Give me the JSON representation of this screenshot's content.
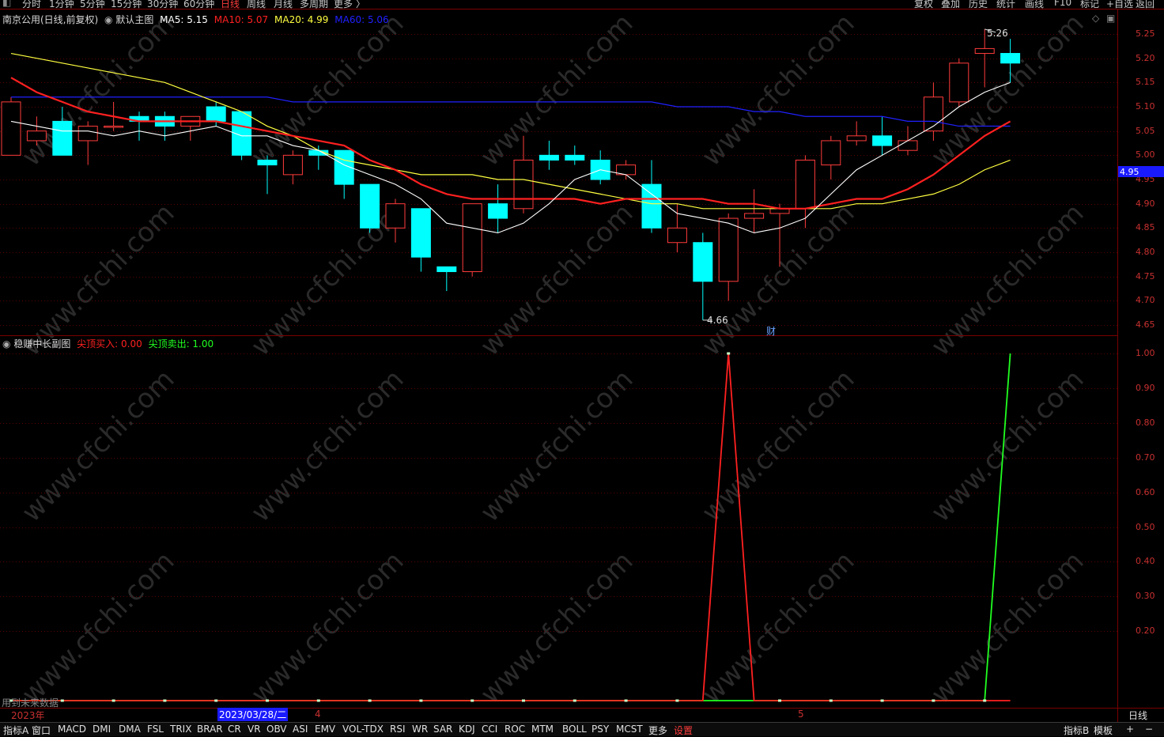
{
  "toolbar": {
    "tabs": [
      "分时",
      "1分钟",
      "5分钟",
      "15分钟",
      "30分钟",
      "60分钟",
      "日线",
      "周线",
      "月线",
      "多周期",
      "更多 〉"
    ],
    "active_tab": "日线",
    "right_tools": [
      "复权",
      "叠加",
      "历史",
      "统计",
      "画线",
      "F10",
      "标记",
      "+自选",
      "返回"
    ]
  },
  "main_chart": {
    "legend": {
      "title": "南京公用(日线,前复权)",
      "template": "默认主图",
      "ma5": "MA5: 5.15",
      "ma10": "MA10: 5.07",
      "ma20": "MA20: 4.99",
      "ma60": "MA60: 5.06"
    },
    "price_ticks": [
      "5.25",
      "5.20",
      "5.15",
      "5.10",
      "5.05",
      "5.00",
      "4.95",
      "4.90",
      "4.85",
      "4.80",
      "4.75",
      "4.70",
      "4.65"
    ],
    "current_price": "4.95",
    "high_label": "5.26",
    "low_label": "4.66",
    "finance_marker": "财",
    "colors": {
      "up": "#ff3b3b",
      "down": "#00ffff",
      "ma5": "#ffffff",
      "ma10": "#ff2020",
      "ma20": "#ffff40",
      "ma60": "#2020ff"
    }
  },
  "sub_chart": {
    "legend": {
      "title": "稳赚中长副图",
      "buy": "尖顶买入: 0.00",
      "sell": "尖顶卖出: 1.00"
    },
    "ticks": [
      "1.00",
      "0.90",
      "0.80",
      "0.70",
      "0.60",
      "0.50",
      "0.40",
      "0.30",
      "0.20"
    ],
    "future_note": "用到未来数据",
    "buy_series_color": "#ff2020",
    "sell_series_color": "#20ff20"
  },
  "date_axis": {
    "year_label": "2023年",
    "cursor_date": "2023/03/28/二",
    "month_labels": [
      "4",
      "5"
    ],
    "period_label": "日线"
  },
  "bottom_bar": {
    "left_tabs": [
      "指标A",
      "窗口",
      "MACD",
      "DMI",
      "DMA",
      "FSL",
      "TRIX",
      "BRAR",
      "CR",
      "VR",
      "OBV",
      "ASI",
      "EMV",
      "VOL-TDX",
      "RSI",
      "WR",
      "SAR",
      "KDJ",
      "CCI",
      "ROC",
      "MTM",
      "BOLL",
      "PSY",
      "MCST",
      "更多"
    ],
    "settings": "设置",
    "right_tabs": [
      "指标B",
      "模板",
      "+",
      "−"
    ]
  },
  "watermark": "www.cfchi.com",
  "chart_data": {
    "type": "candlestick",
    "candles": [
      {
        "o": 5.0,
        "c": 5.11,
        "h": 5.12,
        "l": 5.0
      },
      {
        "o": 5.03,
        "c": 5.05,
        "h": 5.08,
        "l": 5.02
      },
      {
        "o": 5.07,
        "c": 5.0,
        "h": 5.1,
        "l": 5.0
      },
      {
        "o": 5.03,
        "c": 5.06,
        "h": 5.07,
        "l": 4.98
      },
      {
        "o": 5.06,
        "c": 5.06,
        "h": 5.11,
        "l": 5.05
      },
      {
        "o": 5.08,
        "c": 5.07,
        "h": 5.09,
        "l": 5.03
      },
      {
        "o": 5.08,
        "c": 5.06,
        "h": 5.09,
        "l": 5.03
      },
      {
        "o": 5.06,
        "c": 5.08,
        "h": 5.08,
        "l": 5.03
      },
      {
        "o": 5.1,
        "c": 5.07,
        "h": 5.11,
        "l": 5.06
      },
      {
        "o": 5.09,
        "c": 5.0,
        "h": 5.09,
        "l": 4.99
      },
      {
        "o": 4.99,
        "c": 4.98,
        "h": 5.0,
        "l": 4.92
      },
      {
        "o": 4.96,
        "c": 5.0,
        "h": 5.01,
        "l": 4.94
      },
      {
        "o": 5.01,
        "c": 5.0,
        "h": 5.02,
        "l": 4.97
      },
      {
        "o": 5.01,
        "c": 4.94,
        "h": 5.01,
        "l": 4.91
      },
      {
        "o": 4.94,
        "c": 4.85,
        "h": 4.94,
        "l": 4.84
      },
      {
        "o": 4.85,
        "c": 4.9,
        "h": 4.91,
        "l": 4.82
      },
      {
        "o": 4.89,
        "c": 4.79,
        "h": 4.89,
        "l": 4.76
      },
      {
        "o": 4.77,
        "c": 4.76,
        "h": 4.77,
        "l": 4.72
      },
      {
        "o": 4.76,
        "c": 4.9,
        "h": 4.9,
        "l": 4.75
      },
      {
        "o": 4.9,
        "c": 4.87,
        "h": 4.94,
        "l": 4.84
      },
      {
        "o": 4.89,
        "c": 4.99,
        "h": 5.04,
        "l": 4.88
      },
      {
        "o": 5.0,
        "c": 4.99,
        "h": 5.03,
        "l": 4.97
      },
      {
        "o": 5.0,
        "c": 4.99,
        "h": 5.02,
        "l": 4.98
      },
      {
        "o": 4.99,
        "c": 4.95,
        "h": 5.01,
        "l": 4.94
      },
      {
        "o": 4.96,
        "c": 4.98,
        "h": 4.99,
        "l": 4.95
      },
      {
        "o": 4.94,
        "c": 4.85,
        "h": 4.99,
        "l": 4.84
      },
      {
        "o": 4.82,
        "c": 4.85,
        "h": 4.9,
        "l": 4.8
      },
      {
        "o": 4.82,
        "c": 4.74,
        "h": 4.84,
        "l": 4.66
      },
      {
        "o": 4.74,
        "c": 4.87,
        "h": 4.88,
        "l": 4.7
      },
      {
        "o": 4.87,
        "c": 4.88,
        "h": 4.93,
        "l": 4.84
      },
      {
        "o": 4.88,
        "c": 4.89,
        "h": 4.9,
        "l": 4.77
      },
      {
        "o": 4.89,
        "c": 4.99,
        "h": 5.0,
        "l": 4.85
      },
      {
        "o": 4.98,
        "c": 5.03,
        "h": 5.04,
        "l": 4.95
      },
      {
        "o": 5.03,
        "c": 5.04,
        "h": 5.07,
        "l": 5.02
      },
      {
        "o": 5.04,
        "c": 5.02,
        "h": 5.08,
        "l": 5.0
      },
      {
        "o": 5.01,
        "c": 5.03,
        "h": 5.06,
        "l": 5.0
      },
      {
        "o": 5.05,
        "c": 5.12,
        "h": 5.15,
        "l": 5.03
      },
      {
        "o": 5.11,
        "c": 5.19,
        "h": 5.2,
        "l": 5.1
      },
      {
        "o": 5.21,
        "c": 5.22,
        "h": 5.26,
        "l": 5.14
      },
      {
        "o": 5.21,
        "c": 5.19,
        "h": 5.24,
        "l": 5.15
      }
    ],
    "ma5": [
      5.07,
      5.06,
      5.05,
      5.05,
      5.04,
      5.05,
      5.04,
      5.05,
      5.06,
      5.04,
      5.04,
      5.02,
      5.01,
      4.98,
      4.96,
      4.94,
      4.91,
      4.86,
      4.85,
      4.84,
      4.86,
      4.9,
      4.95,
      4.97,
      4.96,
      4.92,
      4.88,
      4.87,
      4.86,
      4.84,
      4.85,
      4.87,
      4.92,
      4.97,
      5.0,
      5.03,
      5.06,
      5.1,
      5.13,
      5.15
    ],
    "ma10": [
      5.16,
      5.13,
      5.11,
      5.09,
      5.08,
      5.07,
      5.07,
      5.07,
      5.07,
      5.06,
      5.05,
      5.04,
      5.03,
      5.02,
      4.99,
      4.97,
      4.94,
      4.92,
      4.91,
      4.91,
      4.91,
      4.91,
      4.91,
      4.9,
      4.91,
      4.91,
      4.91,
      4.91,
      4.9,
      4.9,
      4.89,
      4.89,
      4.9,
      4.91,
      4.91,
      4.93,
      4.96,
      5.0,
      5.04,
      5.07
    ],
    "ma20": [
      5.21,
      5.2,
      5.19,
      5.18,
      5.17,
      5.16,
      5.15,
      5.13,
      5.11,
      5.09,
      5.06,
      5.04,
      5.01,
      4.99,
      4.98,
      4.97,
      4.96,
      4.96,
      4.96,
      4.95,
      4.95,
      4.94,
      4.93,
      4.92,
      4.91,
      4.9,
      4.9,
      4.89,
      4.89,
      4.89,
      4.89,
      4.89,
      4.89,
      4.9,
      4.9,
      4.91,
      4.92,
      4.94,
      4.97,
      4.99
    ],
    "ma60": [
      5.12,
      5.12,
      5.12,
      5.12,
      5.12,
      5.12,
      5.12,
      5.12,
      5.12,
      5.12,
      5.12,
      5.11,
      5.11,
      5.11,
      5.11,
      5.11,
      5.11,
      5.11,
      5.11,
      5.11,
      5.11,
      5.11,
      5.11,
      5.11,
      5.11,
      5.11,
      5.1,
      5.1,
      5.1,
      5.09,
      5.09,
      5.08,
      5.08,
      5.08,
      5.08,
      5.07,
      5.07,
      5.06,
      5.06,
      5.06
    ],
    "buy_signal": [
      0,
      0,
      0,
      0,
      0,
      0,
      0,
      0,
      0,
      0,
      0,
      0,
      0,
      0,
      0,
      0,
      0,
      0,
      0,
      0,
      0,
      0,
      0,
      0,
      0,
      0,
      0,
      0,
      1,
      0,
      0,
      0,
      0,
      0,
      0,
      0,
      0,
      0,
      0,
      0
    ],
    "sell_signal": [
      0,
      0,
      0,
      0,
      0,
      0,
      0,
      0,
      0,
      0,
      0,
      0,
      0,
      0,
      0,
      0,
      0,
      0,
      0,
      0,
      0,
      0,
      0,
      0,
      0,
      0,
      0,
      0,
      0,
      0,
      0,
      0,
      0,
      0,
      0,
      0,
      0,
      0,
      0,
      1
    ],
    "ylim_main": [
      4.63,
      5.3
    ],
    "ylim_sub": [
      0,
      1.0
    ]
  }
}
